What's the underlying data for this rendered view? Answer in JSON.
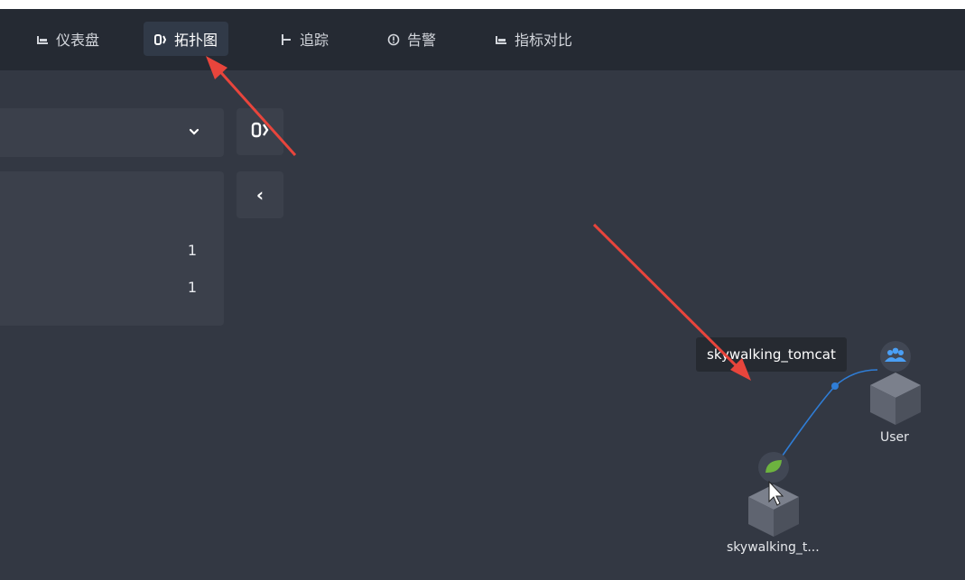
{
  "nav": {
    "items": [
      {
        "label": "仪表盘",
        "icon": "dashboard-icon"
      },
      {
        "label": "拓扑图",
        "icon": "topology-icon",
        "active": true
      },
      {
        "label": "追踪",
        "icon": "trace-icon"
      },
      {
        "label": "告警",
        "icon": "alarm-icon"
      },
      {
        "label": "指标对比",
        "icon": "metric-compare-icon"
      }
    ]
  },
  "panel": {
    "counts": [
      "1",
      "1"
    ]
  },
  "buttons": {
    "collapse_label": "‹"
  },
  "topology": {
    "tooltip": "skywalking_tomcat",
    "nodes": [
      {
        "label": "User",
        "icon": "users-icon"
      },
      {
        "label": "skywalking_t...",
        "icon": "spring-leaf-icon"
      }
    ]
  },
  "colors": {
    "accent": "#2f7dd6",
    "arrow": "#e8453c",
    "leaf": "#6db33f"
  }
}
